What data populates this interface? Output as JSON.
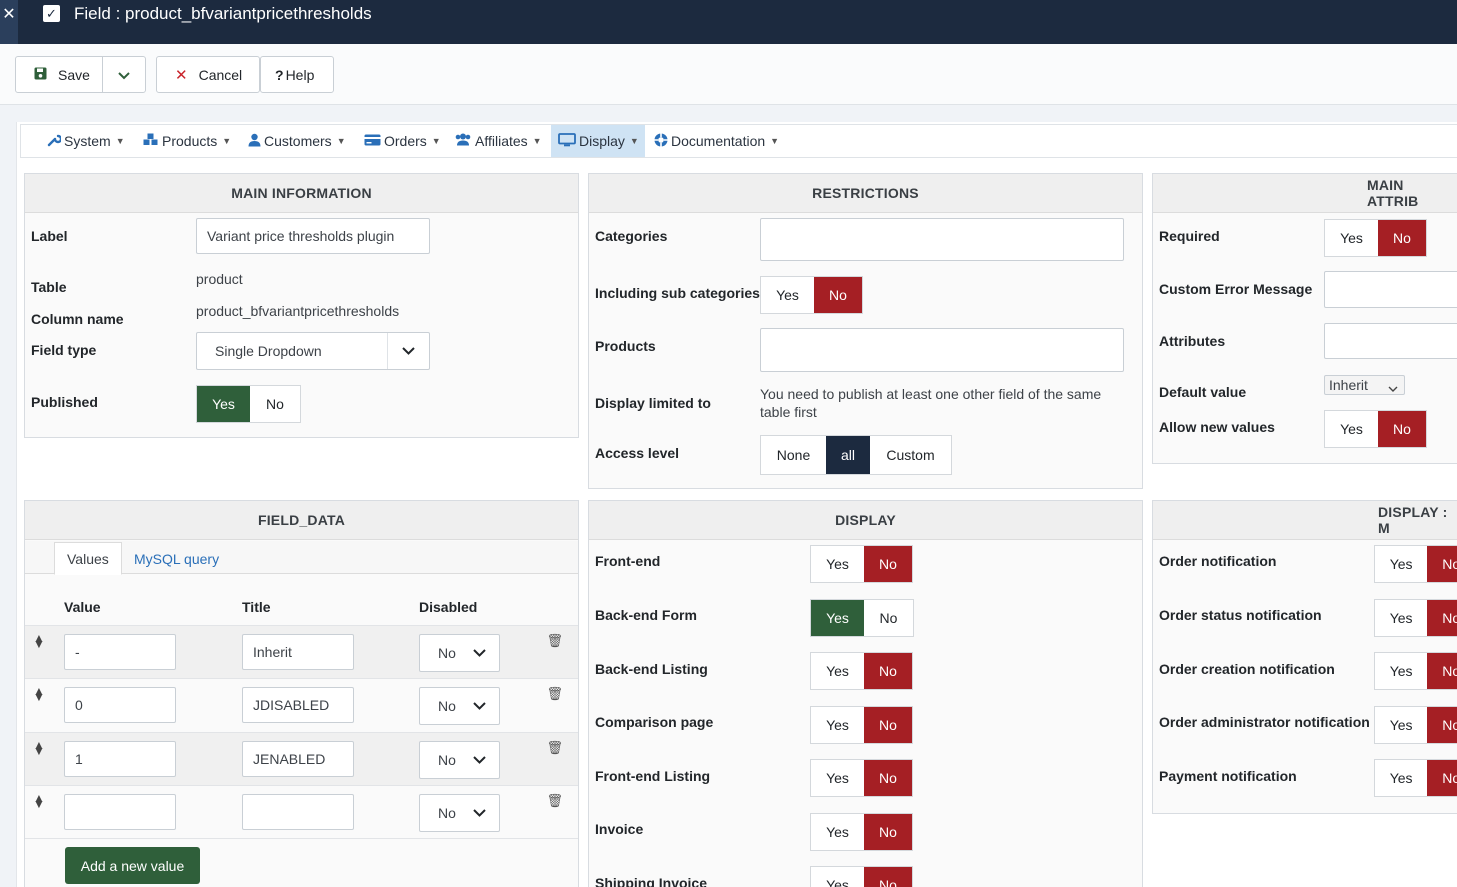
{
  "header": {
    "title": "Field : product_bfvariantpricethresholds"
  },
  "toolbar": {
    "save": "Save",
    "cancel": "Cancel",
    "help": "Help"
  },
  "menu": {
    "items": [
      {
        "label": "System",
        "icon": "wrench-icon"
      },
      {
        "label": "Products",
        "icon": "cubes-icon"
      },
      {
        "label": "Customers",
        "icon": "user-icon"
      },
      {
        "label": "Orders",
        "icon": "credit-card-icon"
      },
      {
        "label": "Affiliates",
        "icon": "users-icon"
      },
      {
        "label": "Display",
        "icon": "monitor-icon"
      },
      {
        "label": "Documentation",
        "icon": "lifebuoy-icon"
      }
    ],
    "active": "Display"
  },
  "main_information": {
    "heading": "MAIN INFORMATION",
    "label_label": "Label",
    "label_value": "Variant price thresholds plugin",
    "table_label": "Table",
    "table_value": "product",
    "column_label": "Column name",
    "column_value": "product_bfvariantpricethresholds",
    "fieldtype_label": "Field type",
    "fieldtype_value": "Single Dropdown",
    "published_label": "Published"
  },
  "restrictions": {
    "heading": "RESTRICTIONS",
    "categories_label": "Categories",
    "subcat_label": "Including sub categories",
    "products_label": "Products",
    "display_limited_label": "Display limited to",
    "display_limited_note": "You need to publish at least one other field of the same",
    "display_limited_note2": "table first",
    "access_label": "Access level",
    "access_none": "None",
    "access_all": "all",
    "access_custom": "Custom"
  },
  "main_attributes": {
    "heading": "MAIN ATTRIB",
    "required_label": "Required",
    "error_label": "Custom Error Message",
    "attributes_label": "Attributes",
    "default_label": "Default value",
    "default_value": "Inherit",
    "allow_label": "Allow new values"
  },
  "field_data": {
    "heading": "FIELD_DATA",
    "tab_values": "Values",
    "tab_mysql": "MySQL query",
    "col_value": "Value",
    "col_title": "Title",
    "col_disabled": "Disabled",
    "rows": [
      {
        "value": "-",
        "title": "Inherit",
        "disabled": "No"
      },
      {
        "value": "0",
        "title": "JDISABLED",
        "disabled": "No"
      },
      {
        "value": "1",
        "title": "JENABLED",
        "disabled": "No"
      },
      {
        "value": "",
        "title": "",
        "disabled": "No"
      }
    ],
    "add_label": "Add a new value"
  },
  "display": {
    "heading": "DISPLAY",
    "rows": [
      {
        "label": "Front-end",
        "state": "No"
      },
      {
        "label": "Back-end Form",
        "state": "Yes"
      },
      {
        "label": "Back-end Listing",
        "state": "No"
      },
      {
        "label": "Comparison page",
        "state": "No"
      },
      {
        "label": "Front-end Listing",
        "state": "No"
      },
      {
        "label": "Invoice",
        "state": "No"
      },
      {
        "label": "Shipping Invoice",
        "state": "No"
      }
    ]
  },
  "display_mail": {
    "heading": "DISPLAY : M",
    "rows": [
      {
        "label": "Order notification"
      },
      {
        "label": "Order status notification"
      },
      {
        "label": "Order creation notification"
      },
      {
        "label": "Order administrator notification"
      },
      {
        "label": "Payment notification"
      }
    ]
  },
  "toggle": {
    "yes": "Yes",
    "no": "No",
    "no_clipped": "No"
  },
  "colors": {
    "topbar": "#1c2a3f",
    "red": "#a51f24",
    "green": "#2f5f3a",
    "link": "#2a6fb8"
  }
}
